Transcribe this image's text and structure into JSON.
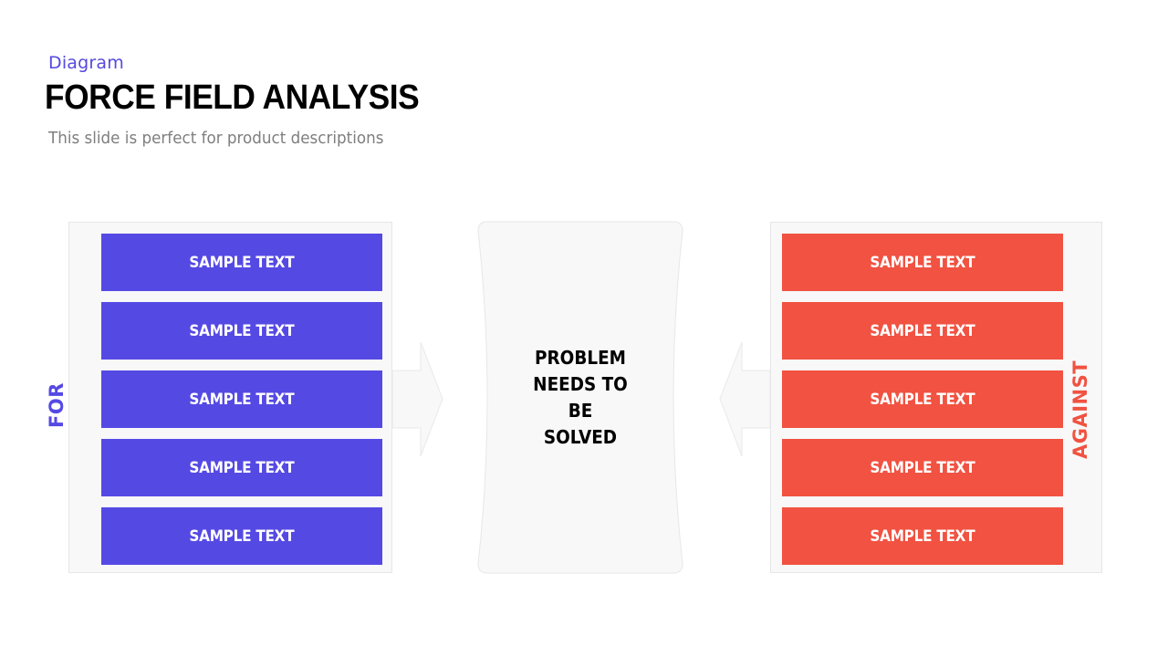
{
  "header": {
    "kicker": "Diagram",
    "title": "FORCE FIELD ANALYSIS",
    "subtitle": "This slide is perfect for product descriptions"
  },
  "colors": {
    "for": "#5549e4",
    "against": "#f15241",
    "panel": "#f8f8f9",
    "kicker": "#5548e0"
  },
  "for_side": {
    "label": "FOR",
    "items": [
      "SAMPLE TEXT",
      "SAMPLE TEXT",
      "SAMPLE TEXT",
      "SAMPLE TEXT",
      "SAMPLE TEXT"
    ]
  },
  "against_side": {
    "label": "AGAINST",
    "items": [
      "SAMPLE TEXT",
      "SAMPLE TEXT",
      "SAMPLE TEXT",
      "SAMPLE TEXT",
      "SAMPLE TEXT"
    ]
  },
  "center": {
    "text": "PROBLEM NEEDS TO BE SOLVED"
  }
}
